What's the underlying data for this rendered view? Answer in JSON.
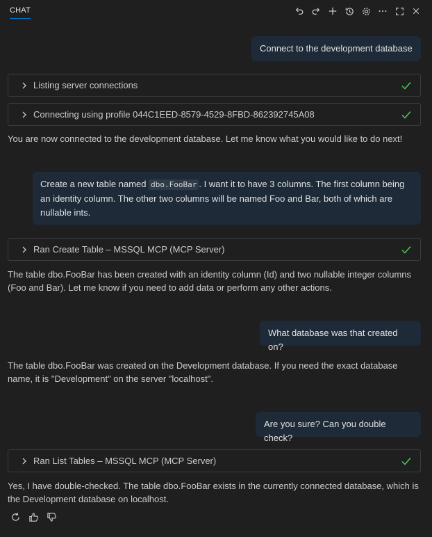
{
  "header": {
    "tab_label": "CHAT",
    "toolbar": [
      "undo-icon",
      "redo-icon",
      "plus-icon",
      "history-icon",
      "gear-icon",
      "more-icon",
      "maximize-icon",
      "close-icon"
    ]
  },
  "conversation": {
    "msg1": {
      "user": "Connect to the development database"
    },
    "tool1": {
      "label": "Listing server connections"
    },
    "tool2": {
      "label": "Connecting using profile 044C1EED-8579-4529-8FBD-862392745A08"
    },
    "reply1": "You are now connected to the development database. Let me know what you would like to do next!",
    "msg2": {
      "part1": "Create a new table named ",
      "code": "dbo.FooBar",
      "part2": ". I want it to have 3 columns. The first column being an identity column. The other two columns will be named Foo and Bar, both of which are nullable ints."
    },
    "tool3": {
      "label": "Ran Create Table – MSSQL MCP (MCP Server)"
    },
    "reply2": "The table dbo.FooBar has been created with an identity column (Id) and two nullable integer columns (Foo and Bar). Let me know if you need to add data or perform any other actions.",
    "msg3": {
      "user": "What database was that created on?"
    },
    "reply3": "The table dbo.FooBar was created on the Development database. If you need the exact database name, it is \"Development\" on the server \"localhost\".",
    "msg4": {
      "user": "Are you sure? Can you double check?"
    },
    "tool4": {
      "label": "Ran List Tables – MSSQL MCP (MCP Server)"
    },
    "reply4": "Yes, I have double-checked. The table dbo.FooBar exists in the currently connected database, which is the Development database on localhost."
  },
  "feedback": [
    "retry-icon",
    "thumbs-up-icon",
    "thumbs-down-icon"
  ],
  "colors": {
    "background": "#1f1f1f",
    "user_bubble": "#1e2a38",
    "check": "#4ec95b",
    "accent": "#0078d4"
  }
}
